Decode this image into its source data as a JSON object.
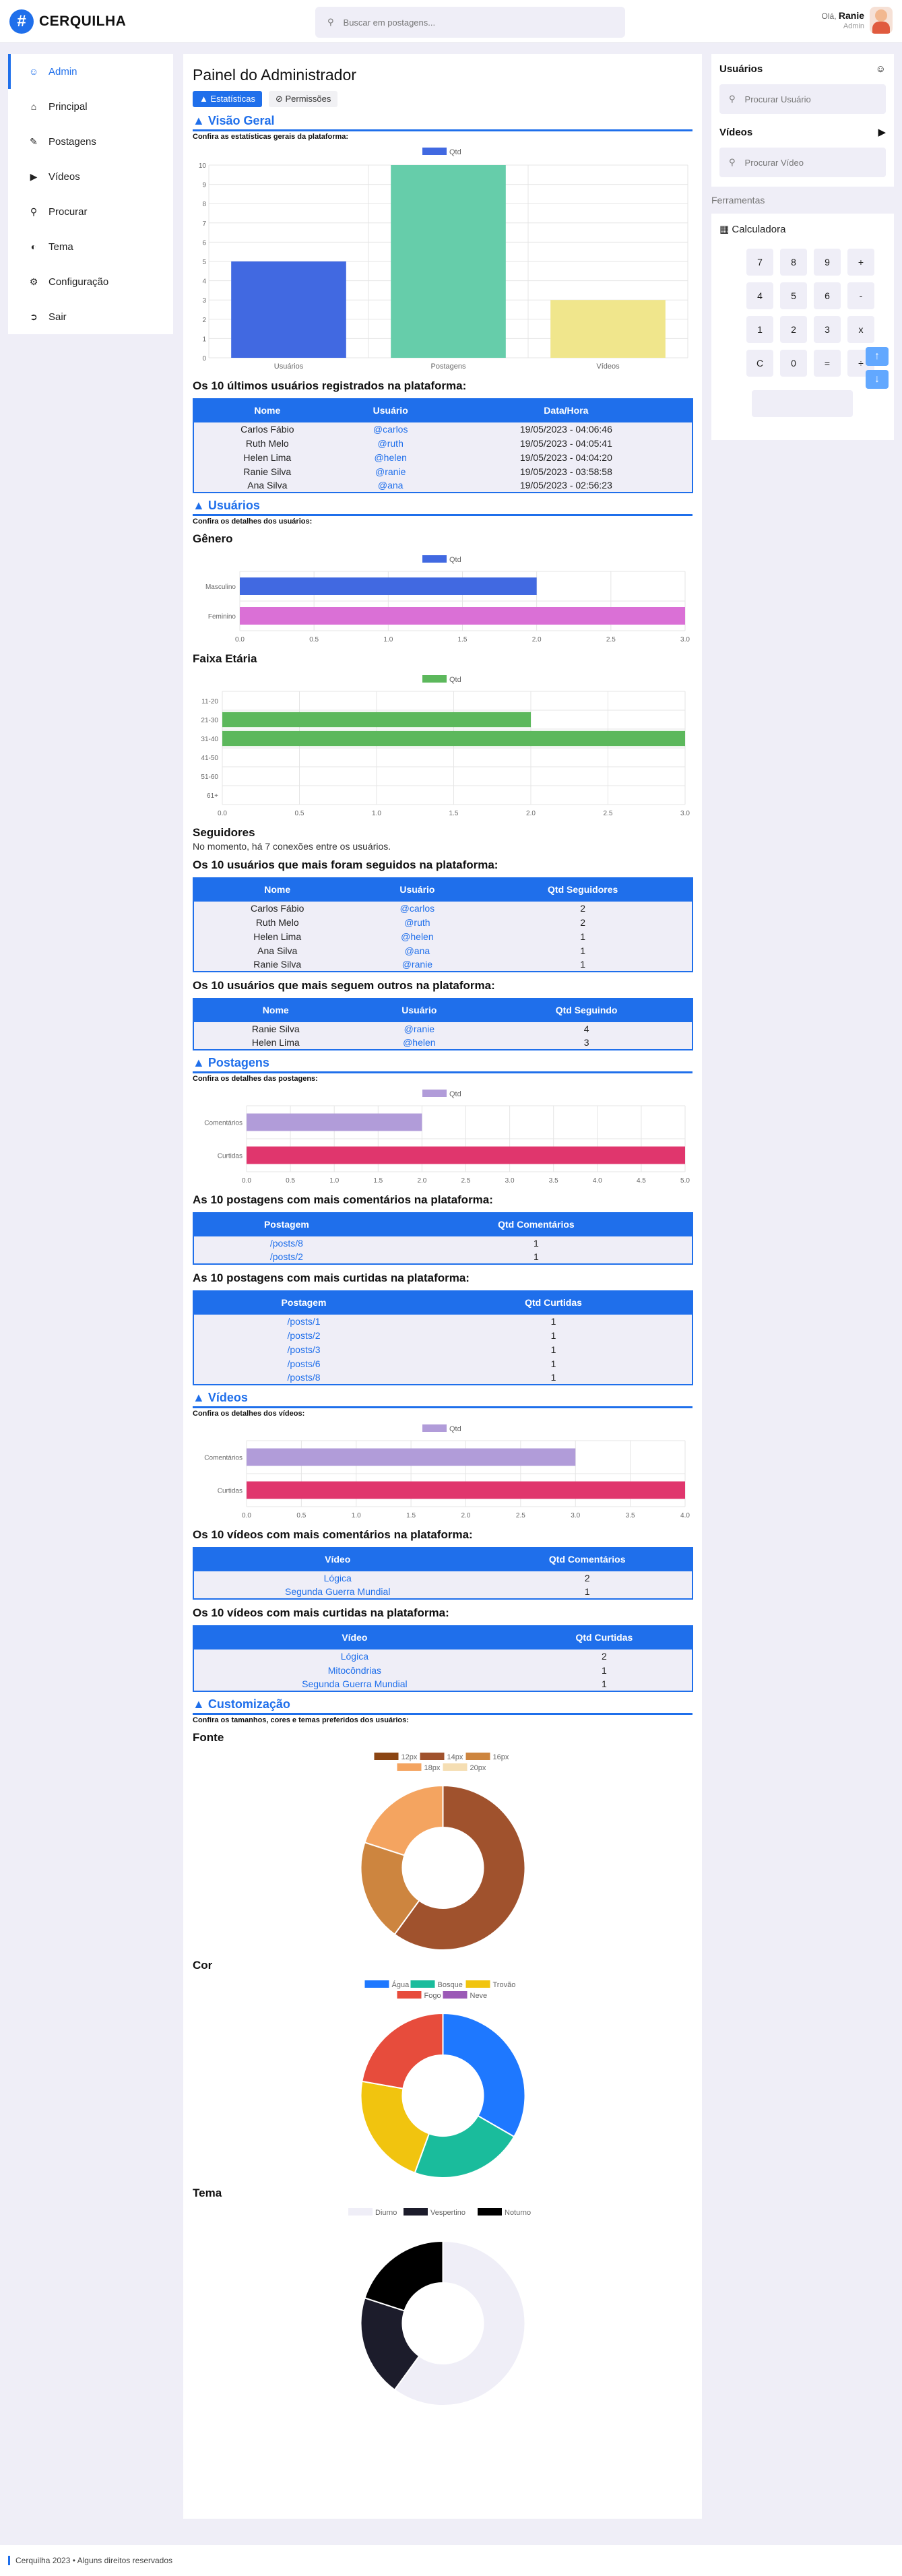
{
  "header": {
    "brand": "CERQUILHA",
    "search_placeholder": "Buscar em postagens...",
    "greeting": "Olá,",
    "username": "Ranie",
    "role": "Admin"
  },
  "sidebar": {
    "items": [
      {
        "label": "Admin",
        "icon": "user-icon",
        "active": true
      },
      {
        "label": "Principal",
        "icon": "home-icon"
      },
      {
        "label": "Postagens",
        "icon": "pencil-icon"
      },
      {
        "label": "Vídeos",
        "icon": "video-icon"
      },
      {
        "label": "Procurar",
        "icon": "search-icon"
      },
      {
        "label": "Tema",
        "icon": "palette-icon"
      },
      {
        "label": "Configuração",
        "icon": "gear-icon"
      },
      {
        "label": "Sair",
        "icon": "logout-icon"
      }
    ]
  },
  "main": {
    "title": "Painel do Administrador",
    "tabs": [
      {
        "label": "Estatísticas"
      },
      {
        "label": "Permissões"
      }
    ],
    "overview": {
      "title": "Visão Geral",
      "subtitle": "Confira as estatísticas gerais da plataforma:"
    },
    "recent_users": {
      "title": "Os 10 últimos usuários registrados na plataforma:",
      "headers": [
        "Nome",
        "Usuário",
        "Data/Hora"
      ],
      "rows": [
        [
          "Carlos Fábio",
          "@carlos",
          "19/05/2023 - 04:06:46"
        ],
        [
          "Ruth Melo",
          "@ruth",
          "19/05/2023 - 04:05:41"
        ],
        [
          "Helen Lima",
          "@helen",
          "19/05/2023 - 04:04:20"
        ],
        [
          "Ranie Silva",
          "@ranie",
          "19/05/2023 - 03:58:58"
        ],
        [
          "Ana Silva",
          "@ana",
          "19/05/2023 - 02:56:23"
        ]
      ]
    },
    "users": {
      "title": "Usuários",
      "subtitle": "Confira os detalhes dos usuários:",
      "gender_title": "Gênero",
      "age_title": "Faixa Etária"
    },
    "followers": {
      "title": "Seguidores",
      "text": "No momento, há 7 conexões entre os usuários.",
      "most_followed_title": "Os 10 usuários que mais foram seguidos na plataforma:",
      "most_followed_headers": [
        "Nome",
        "Usuário",
        "Qtd Seguidores"
      ],
      "most_followed_rows": [
        [
          "Carlos Fábio",
          "@carlos",
          "2"
        ],
        [
          "Ruth Melo",
          "@ruth",
          "2"
        ],
        [
          "Helen Lima",
          "@helen",
          "1"
        ],
        [
          "Ana Silva",
          "@ana",
          "1"
        ],
        [
          "Ranie Silva",
          "@ranie",
          "1"
        ]
      ],
      "most_following_title": "Os 10 usuários que mais seguem outros na plataforma:",
      "most_following_headers": [
        "Nome",
        "Usuário",
        "Qtd Seguindo"
      ],
      "most_following_rows": [
        [
          "Ranie Silva",
          "@ranie",
          "4"
        ],
        [
          "Helen Lima",
          "@helen",
          "3"
        ]
      ]
    },
    "posts": {
      "title": "Postagens",
      "subtitle": "Confira os detalhes das postagens:",
      "comments_title": "As 10 postagens com mais comentários na plataforma:",
      "comments_headers": [
        "Postagem",
        "Qtd Comentários"
      ],
      "comments_rows": [
        [
          "/posts/8",
          "1"
        ],
        [
          "/posts/2",
          "1"
        ]
      ],
      "likes_title": "As 10 postagens com mais curtidas na plataforma:",
      "likes_headers": [
        "Postagem",
        "Qtd Curtidas"
      ],
      "likes_rows": [
        [
          "/posts/1",
          "1"
        ],
        [
          "/posts/2",
          "1"
        ],
        [
          "/posts/3",
          "1"
        ],
        [
          "/posts/6",
          "1"
        ],
        [
          "/posts/8",
          "1"
        ]
      ]
    },
    "videos": {
      "title": "Vídeos",
      "subtitle": "Confira os detalhes dos vídeos:",
      "comments_title": "Os 10 vídeos com mais comentários na plataforma:",
      "comments_headers": [
        "Vídeo",
        "Qtd Comentários"
      ],
      "comments_rows": [
        [
          "Lógica",
          "2"
        ],
        [
          "Segunda Guerra Mundial",
          "1"
        ]
      ],
      "likes_title": "Os 10 vídeos com mais curtidas na plataforma:",
      "likes_headers": [
        "Vídeo",
        "Qtd Curtidas"
      ],
      "likes_rows": [
        [
          "Lógica",
          "2"
        ],
        [
          "Mitocôndrias",
          "1"
        ],
        [
          "Segunda Guerra Mundial",
          "1"
        ]
      ]
    },
    "custom": {
      "title": "Customização",
      "subtitle": "Confira os tamanhos, cores e temas preferidos dos usuários:",
      "font_title": "Fonte",
      "color_title": "Cor",
      "theme_title": "Tema"
    }
  },
  "chart_data": [
    {
      "type": "bar",
      "legend": [
        "Qtd"
      ],
      "categories": [
        "Usuários",
        "Postagens",
        "Vídeos"
      ],
      "values": [
        5,
        10,
        3
      ],
      "ylim": [
        0,
        10
      ],
      "colors": [
        "#4169e1",
        "#66cdaa",
        "#f0e68c"
      ]
    },
    {
      "type": "bar",
      "orientation": "horizontal",
      "legend": [
        "Qtd"
      ],
      "categories": [
        "Masculino",
        "Feminino"
      ],
      "values": [
        2,
        3
      ],
      "xlim": [
        0,
        3
      ],
      "colors": [
        "#4169e1",
        "#da70d6"
      ]
    },
    {
      "type": "bar",
      "orientation": "horizontal",
      "legend": [
        "Qtd"
      ],
      "categories": [
        "11-20",
        "21-30",
        "31-40",
        "41-50",
        "51-60",
        "61+"
      ],
      "values": [
        0,
        2,
        3,
        0,
        0,
        0
      ],
      "xlim": [
        0,
        3
      ],
      "colors": [
        "#5cb85c"
      ]
    },
    {
      "type": "bar",
      "orientation": "horizontal",
      "legend": [
        "Qtd"
      ],
      "categories": [
        "Comentários",
        "Curtidas"
      ],
      "values": [
        2,
        5
      ],
      "xlim": [
        0,
        5
      ],
      "colors": [
        "#b19cd9",
        "#e0366d"
      ]
    },
    {
      "type": "bar",
      "orientation": "horizontal",
      "legend": [
        "Qtd"
      ],
      "categories": [
        "Comentários",
        "Curtidas"
      ],
      "values": [
        3,
        4
      ],
      "xlim": [
        0,
        4
      ],
      "colors": [
        "#b19cd9",
        "#e0366d"
      ]
    },
    {
      "type": "pie",
      "categories": [
        "12px",
        "14px",
        "16px",
        "18px",
        "20px"
      ],
      "values": [
        0,
        6,
        2,
        2,
        0
      ],
      "colors": [
        "#8b4513",
        "#a0522d",
        "#cd853f",
        "#f4a460",
        "#f5deb3"
      ]
    },
    {
      "type": "pie",
      "categories": [
        "Água",
        "Bosque",
        "Trovão",
        "Fogo",
        "Neve"
      ],
      "values": [
        3,
        2,
        2,
        2,
        0
      ],
      "colors": [
        "#1e78ff",
        "#1abc9c",
        "#f1c40f",
        "#e74c3c",
        "#9b59b6"
      ]
    },
    {
      "type": "pie",
      "categories": [
        "Diurno",
        "Vespertino",
        "Noturno"
      ],
      "values": [
        6,
        2,
        2
      ],
      "colors": [
        "#efeef7",
        "#1c1c2b",
        "#000000"
      ]
    }
  ],
  "right": {
    "users_title": "Usuários",
    "users_placeholder": "Procurar Usuário",
    "videos_title": "Vídeos",
    "videos_placeholder": "Procurar Vídeo",
    "tools_label": "Ferramentas",
    "calc_title": "Calculadora",
    "keys": [
      "7",
      "8",
      "9",
      "+",
      "4",
      "5",
      "6",
      "-",
      "1",
      "2",
      "3",
      "x",
      "C",
      "0",
      "=",
      "÷"
    ],
    "up_arrow": "↑",
    "down_arrow": "↓"
  },
  "footer": {
    "text": "Cerquilha 2023 • Alguns direitos reservados"
  }
}
